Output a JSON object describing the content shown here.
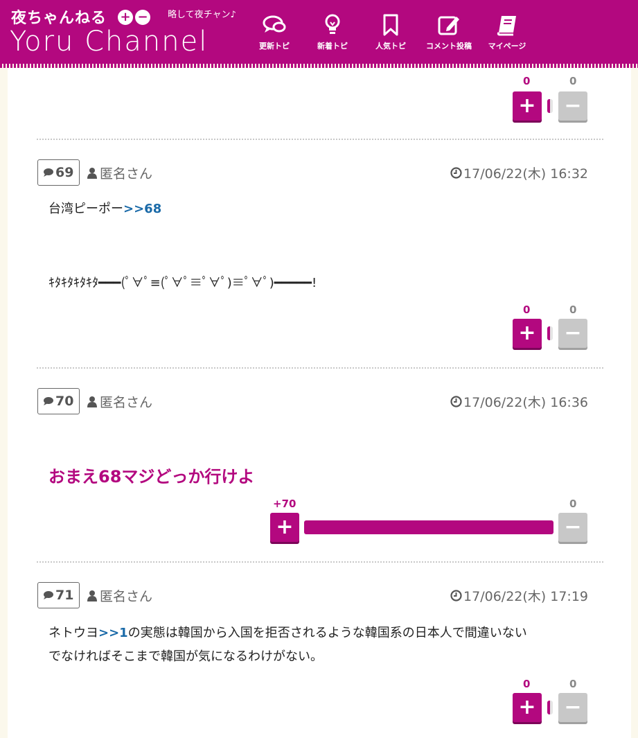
{
  "header": {
    "logo_jp": "夜ちゃんねる",
    "logo_plus": "+",
    "logo_minus": "−",
    "logo_sub": "略して夜チャン♪",
    "logo_en": "Yoru Channel",
    "nav": [
      {
        "label": "更新トピ",
        "icon": "chat-bubbles-icon"
      },
      {
        "label": "新着トピ",
        "icon": "lightbulb-icon"
      },
      {
        "label": "人気トピ",
        "icon": "bookmark-icon"
      },
      {
        "label": "コメント投稿",
        "icon": "edit-icon"
      },
      {
        "label": "マイページ",
        "icon": "book-icon"
      }
    ]
  },
  "top_vote": {
    "plus": "0",
    "minus": "0",
    "ratio": 0
  },
  "comments": [
    {
      "number": "69",
      "author": "匿名さん",
      "date": "17/06/22(木) 16:32",
      "line1_text": "台湾ピーポー",
      "line1_anchor": ">>68",
      "line2": "ｷﾀｷﾀｷﾀｷﾀ━━━(ﾟ∀ﾟ≡(ﾟ∀ﾟ≡ﾟ∀ﾟ)≡ﾟ∀ﾟ)━━━━━!",
      "vote": {
        "plus": "0",
        "minus": "0",
        "ratio": 0
      }
    },
    {
      "number": "70",
      "author": "匿名さん",
      "date": "17/06/22(木) 16:36",
      "big_text": "おまえ68マジどっか行けよ",
      "vote": {
        "plus": "+70",
        "minus": "0",
        "ratio": 1.0
      }
    },
    {
      "number": "71",
      "author": "匿名さん",
      "date": "17/06/22(木) 17:19",
      "line1_text": "ネトウヨ",
      "line1_anchor": ">>1",
      "line1_rest": "の実態は韓国から入国を拒否されるような韓国系の日本人で間違いない",
      "line2": "でなければそこまで韓国が気になるわけがない。",
      "vote": {
        "plus": "0",
        "minus": "0",
        "ratio": 0
      }
    }
  ],
  "colors": {
    "brand": "#b3087f",
    "anchor": "#1a6aa8",
    "minus": "#c8c8c8"
  }
}
